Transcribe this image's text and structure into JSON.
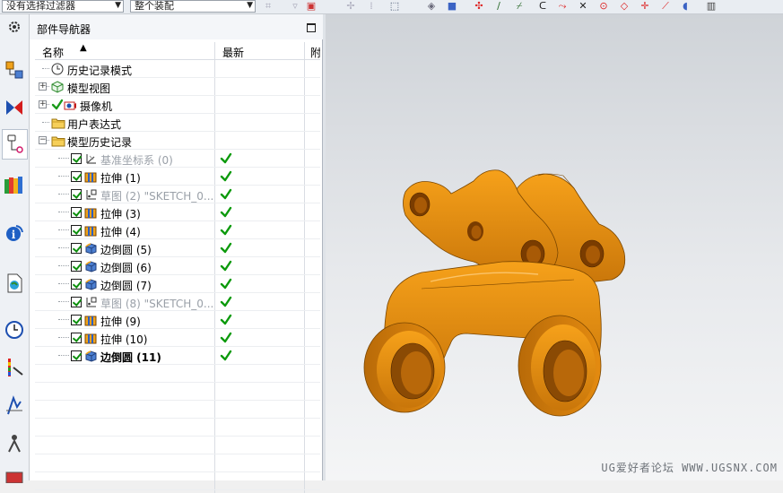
{
  "toolbar": {
    "filter_combo": "没有选择过滤器",
    "scope_combo": "整个装配"
  },
  "navigator": {
    "title": "部件导航器",
    "columns": {
      "name": "名称",
      "latest": "最新",
      "third": "附"
    },
    "nodes": [
      {
        "label": "历史记录模式",
        "icon": "clock-icon",
        "level": 1,
        "expander": "",
        "checked": false,
        "gray": false,
        "bold": false,
        "latest": false
      },
      {
        "label": "模型视图",
        "icon": "model-view-icon",
        "level": 1,
        "expander": "+",
        "checked": false,
        "gray": false,
        "bold": false,
        "latest": false
      },
      {
        "label": "摄像机",
        "icon": "camera-icon",
        "level": 1,
        "expander": "+",
        "checked": true,
        "gray": false,
        "bold": false,
        "latest": false
      },
      {
        "label": "用户表达式",
        "icon": "folder-icon",
        "level": 1,
        "expander": "",
        "checked": false,
        "gray": false,
        "bold": false,
        "latest": false
      },
      {
        "label": "模型历史记录",
        "icon": "folder-icon",
        "level": 1,
        "expander": "-",
        "checked": false,
        "gray": false,
        "bold": false,
        "latest": false
      },
      {
        "label": "基准坐标系 (0)",
        "icon": "datum-csys-icon",
        "level": 2,
        "expander": "",
        "checked": true,
        "gray": true,
        "bold": false,
        "latest": true
      },
      {
        "label": "拉伸 (1)",
        "icon": "extrude-icon",
        "level": 2,
        "expander": "",
        "checked": true,
        "gray": false,
        "bold": false,
        "latest": true
      },
      {
        "label": "草图 (2) \"SKETCH_0...",
        "icon": "sketch-icon",
        "level": 2,
        "expander": "",
        "checked": true,
        "gray": true,
        "bold": false,
        "latest": true
      },
      {
        "label": "拉伸 (3)",
        "icon": "extrude-icon",
        "level": 2,
        "expander": "",
        "checked": true,
        "gray": false,
        "bold": false,
        "latest": true
      },
      {
        "label": "拉伸 (4)",
        "icon": "extrude-icon",
        "level": 2,
        "expander": "",
        "checked": true,
        "gray": false,
        "bold": false,
        "latest": true
      },
      {
        "label": "边倒圆 (5)",
        "icon": "edge-blend-icon",
        "level": 2,
        "expander": "",
        "checked": true,
        "gray": false,
        "bold": false,
        "latest": true
      },
      {
        "label": "边倒圆 (6)",
        "icon": "edge-blend-icon",
        "level": 2,
        "expander": "",
        "checked": true,
        "gray": false,
        "bold": false,
        "latest": true
      },
      {
        "label": "边倒圆 (7)",
        "icon": "edge-blend-icon",
        "level": 2,
        "expander": "",
        "checked": true,
        "gray": false,
        "bold": false,
        "latest": true
      },
      {
        "label": "草图 (8) \"SKETCH_0...",
        "icon": "sketch-icon",
        "level": 2,
        "expander": "",
        "checked": true,
        "gray": true,
        "bold": false,
        "latest": true
      },
      {
        "label": "拉伸 (9)",
        "icon": "extrude-icon",
        "level": 2,
        "expander": "",
        "checked": true,
        "gray": false,
        "bold": false,
        "latest": true
      },
      {
        "label": "拉伸 (10)",
        "icon": "extrude-icon",
        "level": 2,
        "expander": "",
        "checked": true,
        "gray": false,
        "bold": false,
        "latest": true
      },
      {
        "label": "边倒圆 (11)",
        "icon": "edge-blend-icon",
        "level": 2,
        "expander": "",
        "checked": true,
        "gray": false,
        "bold": true,
        "latest": true
      }
    ]
  },
  "viewport": {
    "watermark": "UG爱好者论坛 WWW.UGSNX.COM",
    "model_color": "#e8920a"
  }
}
